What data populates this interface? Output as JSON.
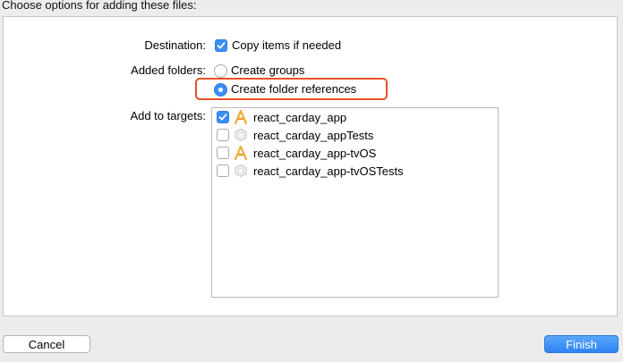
{
  "header": {
    "title": "Choose options for adding these files:"
  },
  "options": {
    "destination_label": "Destination:",
    "copy_items_label": "Copy items if needed",
    "copy_items_checked": true,
    "added_folders_label": "Added folders:",
    "create_groups_label": "Create groups",
    "create_folder_references_label": "Create folder references",
    "selected_folder_option": "Create folder references",
    "add_to_targets_label": "Add to targets:"
  },
  "targets": [
    {
      "name": "react_carday_app",
      "checked": true,
      "icon": "app-icon"
    },
    {
      "name": "react_carday_appTests",
      "checked": false,
      "icon": "test-bundle-icon"
    },
    {
      "name": "react_carday_app-tvOS",
      "checked": false,
      "icon": "app-icon"
    },
    {
      "name": "react_carday_app-tvOSTests",
      "checked": false,
      "icon": "test-bundle-icon"
    }
  ],
  "buttons": {
    "cancel": "Cancel",
    "finish": "Finish"
  },
  "colors": {
    "accent": "#3b8df7",
    "highlight": "#e8512a"
  }
}
